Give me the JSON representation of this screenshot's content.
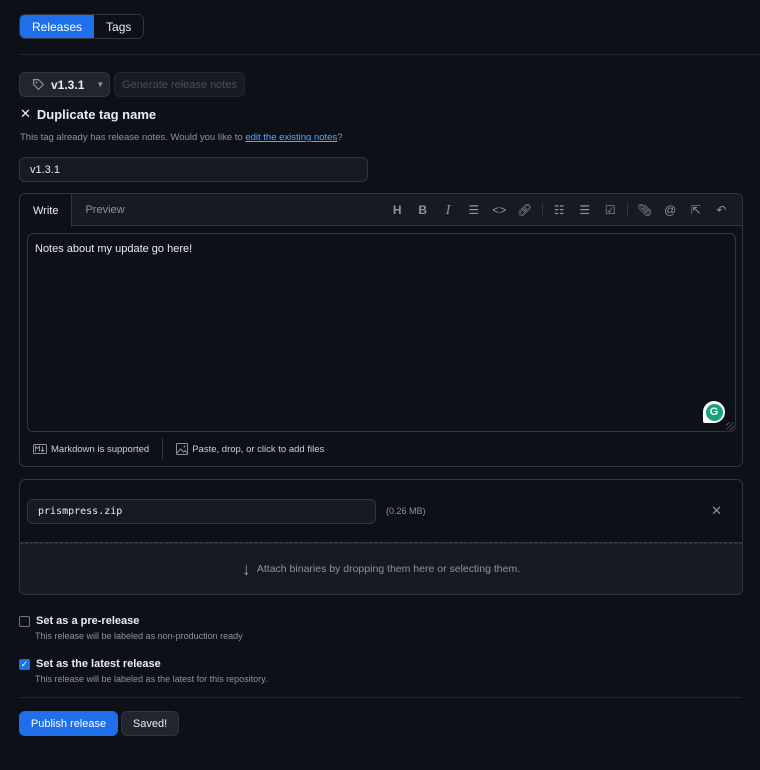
{
  "nav_tabs": [
    {
      "label": "Releases",
      "active": true
    },
    {
      "label": "Tags",
      "active": false
    }
  ],
  "tag_select": {
    "value": "v1.3.1",
    "icon": "tag-icon"
  },
  "generate_notes_label": "Generate release notes",
  "duplicate_warning": {
    "title": "Duplicate tag name",
    "message_prefix": "This tag already has release notes. Would you like to ",
    "link_text": "edit the existing notes",
    "message_suffix": "?"
  },
  "release_title": {
    "value": "v1.3.1"
  },
  "editor": {
    "tabs": [
      {
        "label": "Write",
        "active": true
      },
      {
        "label": "Preview",
        "active": false
      }
    ],
    "toolbar": [
      "heading-icon",
      "bold-icon",
      "italic-icon",
      "quote-icon",
      "code-icon",
      "link-icon",
      "ordered-list-icon",
      "unordered-list-icon",
      "task-list-icon",
      "attach-icon",
      "mention-icon",
      "reference-icon",
      "undo-icon"
    ],
    "body": "Notes about my update go here!",
    "markdown_note": "Markdown is supported",
    "attach_note": "Paste, drop, or click to add files"
  },
  "assets": {
    "files": [
      {
        "name": "prismpress.zip",
        "size": "(0.26 MB)"
      }
    ],
    "dropzone_text": "Attach binaries by dropping them here or selecting them."
  },
  "options": [
    {
      "label": "Set as a pre-release",
      "desc": "This release will be labeled as non-production ready",
      "checked": false
    },
    {
      "label": "Set as the latest release",
      "desc": "This release will be labeled as the latest for this repository.",
      "checked": true
    }
  ],
  "actions": {
    "publish": "Publish release",
    "saved": "Saved!"
  },
  "colors": {
    "accent": "#1f6feb",
    "link": "#58a6ff",
    "background": "#0d1117"
  }
}
